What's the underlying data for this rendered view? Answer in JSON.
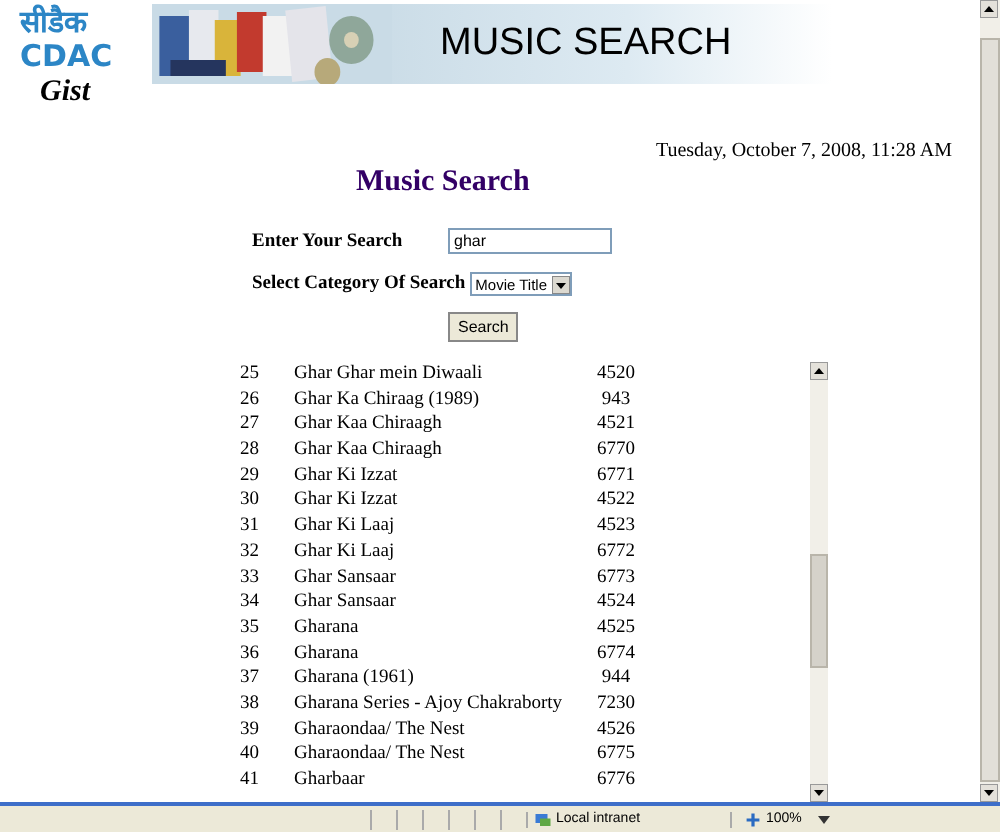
{
  "logo": {
    "devanagari": "सीडैक",
    "latin": "CDAC",
    "tagline": "Gist"
  },
  "banner": {
    "title": "MUSIC SEARCH"
  },
  "datetime": "Tuesday, October 7, 2008, 11:28 AM",
  "heading": "Music Search",
  "form": {
    "search_label": "Enter Your Search",
    "search_value": "ghar",
    "category_label": "Select Category Of Search",
    "category_value": "Movie Title",
    "button": "Search"
  },
  "results": [
    {
      "no": "25",
      "title": "Ghar Ghar mein Diwaali",
      "code": "4520"
    },
    {
      "no": "26",
      "title": "Ghar Ka Chiraag (1989)",
      "code": "943"
    },
    {
      "no": "27",
      "title": "Ghar Kaa Chiraagh",
      "code": "4521"
    },
    {
      "no": "28",
      "title": "Ghar Kaa Chiraagh",
      "code": "6770"
    },
    {
      "no": "29",
      "title": "Ghar Ki Izzat",
      "code": "6771"
    },
    {
      "no": "30",
      "title": "Ghar Ki Izzat",
      "code": "4522"
    },
    {
      "no": "31",
      "title": "Ghar Ki Laaj",
      "code": "4523"
    },
    {
      "no": "32",
      "title": "Ghar Ki Laaj",
      "code": "6772"
    },
    {
      "no": "33",
      "title": "Ghar Sansaar",
      "code": "6773"
    },
    {
      "no": "34",
      "title": "Ghar Sansaar",
      "code": "4524"
    },
    {
      "no": "35",
      "title": "Gharana",
      "code": "4525"
    },
    {
      "no": "36",
      "title": "Gharana",
      "code": "6774"
    },
    {
      "no": "37",
      "title": "Gharana (1961)",
      "code": "944"
    },
    {
      "no": "38",
      "title": "Gharana Series - Ajoy Chakraborty",
      "code": "7230"
    },
    {
      "no": "39",
      "title": "Gharaondaa/ The Nest",
      "code": "4526"
    },
    {
      "no": "40",
      "title": "Gharaondaa/ The Nest",
      "code": "6775"
    },
    {
      "no": "41",
      "title": "Gharbaar",
      "code": "6776"
    }
  ],
  "status_bar": {
    "zone": "Local intranet",
    "zoom": "100%"
  }
}
